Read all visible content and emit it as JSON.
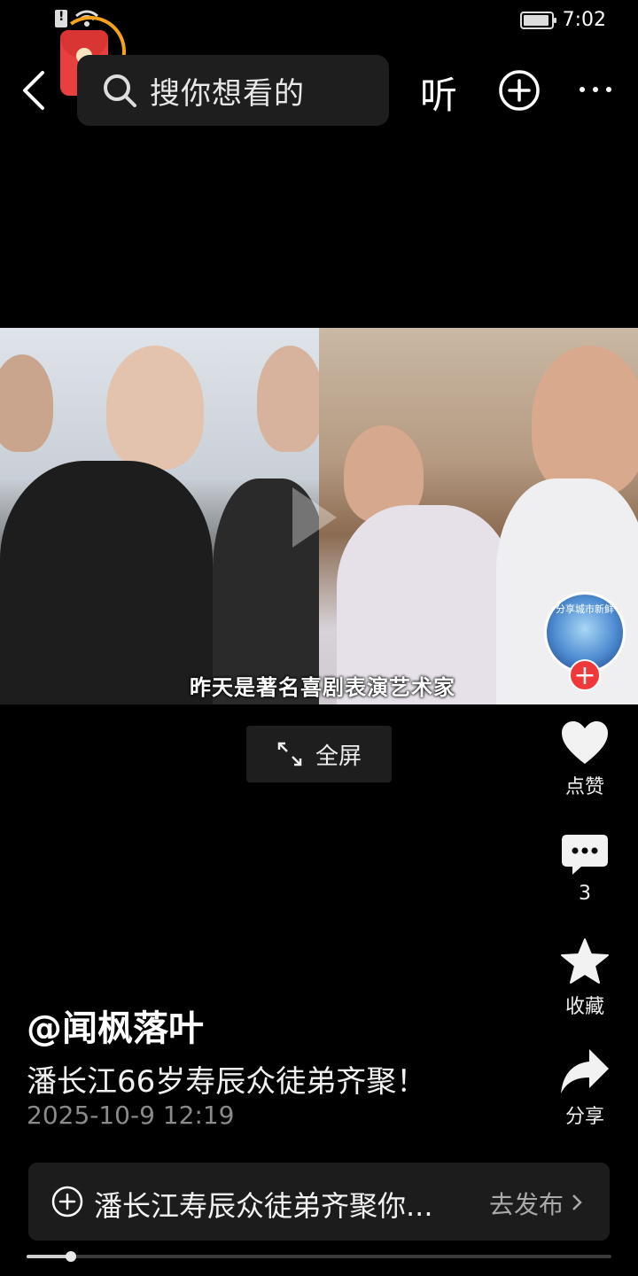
{
  "status_bar": {
    "time": "7:02"
  },
  "search": {
    "placeholder": "搜你想看的"
  },
  "nav": {
    "listen_label": "听"
  },
  "video": {
    "subtitle": "昨天是著名喜剧表演艺术家",
    "author_avatar_text": "分享城市新鲜"
  },
  "fullscreen": {
    "label": "全屏"
  },
  "actions": {
    "like_label": "点赞",
    "comment_count": "3",
    "favorite_label": "收藏",
    "share_label": "分享"
  },
  "post": {
    "author": "@闻枫落叶",
    "caption": "潘长江66岁寿辰众徒弟齐聚！",
    "date": "2025-10-9 12:19"
  },
  "topic": {
    "text": "潘长江寿辰众徒弟齐聚你...",
    "action_label": "去发布"
  },
  "playback": {
    "progress": 0.075
  },
  "colors": {
    "accent_red": "#f0383b",
    "badge_orange": "#f6a21a"
  }
}
